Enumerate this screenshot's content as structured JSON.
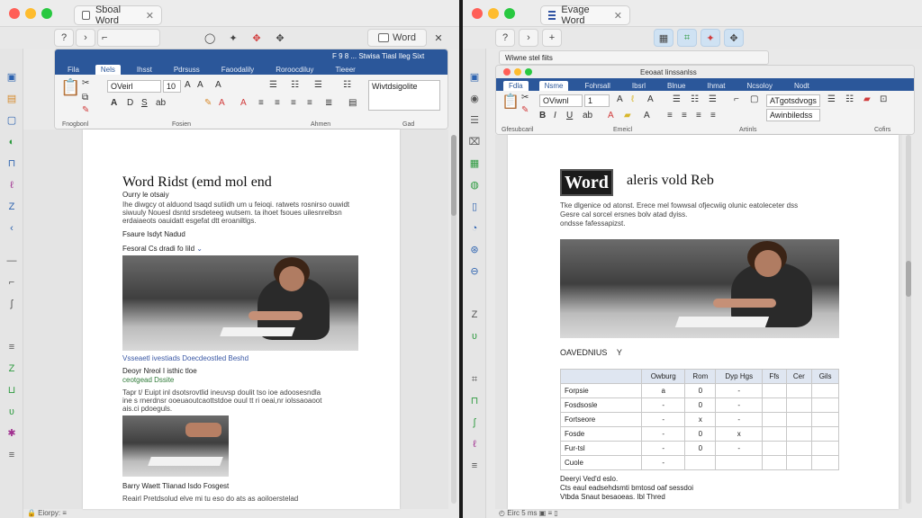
{
  "left": {
    "tab_title": "Sboal Word",
    "toolbar_buttons": [
      "?",
      "›",
      "⌐",
      "◯",
      "✦",
      "✥"
    ],
    "word_button": "Word",
    "ribbon_title": "F 9 8 ... Stwisa    Tiasl  Ileg  Sixt",
    "ribbon_tabs": [
      "Fila",
      "Nels",
      "Ihsst",
      "Pdrsuss",
      "Faoodalily",
      "Roroocdiluy",
      "Tieeer"
    ],
    "font_name": "OVeirl",
    "font_size": "10",
    "style_box": "Wivtdsigolite",
    "group_labels": [
      "Fnogbonl",
      "Fosien",
      "Ahmen",
      "Gad"
    ],
    "doc": {
      "title": "Word Ridst (emd mol end",
      "subtitle": "Ourry le otsaiy",
      "para1": [
        "Ihe diwgcy ot alduond tsaqd sutiidh um u feioqi. ratwets rosnirso ouwidt",
        "siwuuly Nouesl dsntd srsdeteeg wutsem. ta ihoet fsoues uilesnrelbsn",
        "erdaiaeots oauidatt esgefat dtt eroaniltlgs."
      ],
      "label1": "Fsaure Isdyt Nadud",
      "label2": "Fesoral Cs dradi fo Iild",
      "caption": "Vsseaetl ivestiads Doecdeostled Beshd",
      "label3": "Deoyr Nreol I isthic tloe",
      "label4": "ceotgead Dssite",
      "para2": [
        "Tapr t/ Euipt inl dsotsrovtlid ineuvsp doulit tso ioe adoosesndla",
        "ine s rnerdnsr ooeuaoutcaottstdoe ouul tt ri oeai,nr iolssaoaoot",
        "ais.ci pdoeguls."
      ],
      "caption2": "Barry Waett Tlianad Isdo Fosgest",
      "para3": "Reairl Pretdsolud elve mi tu eso do ats as aoiloerstelad"
    },
    "status": "🔒 Eiorpy: ≡ "
  },
  "right": {
    "tab_title": "Evage Word",
    "toolbar_buttons": [
      "?",
      "›",
      "+",
      "▦",
      "⌗",
      "✦",
      "✥"
    ],
    "inner_tab": "Wiwne  stel fiits",
    "ribbon_title": "Eeoaat Iinssanlss",
    "ribbon_tabs": [
      "Fdla",
      "Nsme",
      "Fohrsall",
      "Ibsrl",
      "Blnue",
      "Ihmat",
      "Ncsoloy",
      "Nodt"
    ],
    "font_name": "OViwnl",
    "font_size": "1",
    "style_box1": "ATgotsdvogs",
    "style_box2": "Awinbiledss",
    "group_labels": [
      "Gfesubcaril",
      "Emeicl",
      "Artinls",
      "Cofirs"
    ],
    "doc": {
      "logo": "Word",
      "title": "aleris vold Reb",
      "para": [
        "Tke dlgenice od atonst. Erece mel fowwsal ofjecwiig olunic eatoleceter dss",
        "Gesre cal sorcel ersnes bolv atad dyiss.",
        "ondsse fafessapizst."
      ],
      "section": "OAVEDNIUS",
      "section_mark": "Y",
      "table_head": [
        "",
        "Owburg",
        "Rom",
        "Dyp  Hgs",
        "Ffs",
        "Cer",
        "Gils"
      ],
      "table_rows": [
        [
          "Forpsie",
          "a",
          "0",
          "-"
        ],
        [
          "Fosdsosle",
          "-",
          "0",
          "-"
        ],
        [
          "Fortseore",
          "-",
          "x",
          "-"
        ],
        [
          "Fosde",
          "-",
          "0",
          "x"
        ],
        [
          "Fur-tsl",
          "-",
          "0",
          "-"
        ],
        [
          "Cuole",
          "-",
          "",
          ""
        ]
      ],
      "foot": [
        "Deeryi Ved'd eslo.",
        "Cts eaul eadsehdsmti bmtosd oaf sessdoi",
        "Vtbda Snaut besaoeas.  Ibl  Thred"
      ]
    },
    "status": "◴  Eirc 5 ms   ▣   ≡   ▯"
  },
  "colors": {
    "ribbon_blue": "#2b579a",
    "link_blue": "#3a58a5",
    "mac_red": "#ff5f57",
    "mac_yellow": "#febc2e",
    "mac_green": "#28c840"
  }
}
